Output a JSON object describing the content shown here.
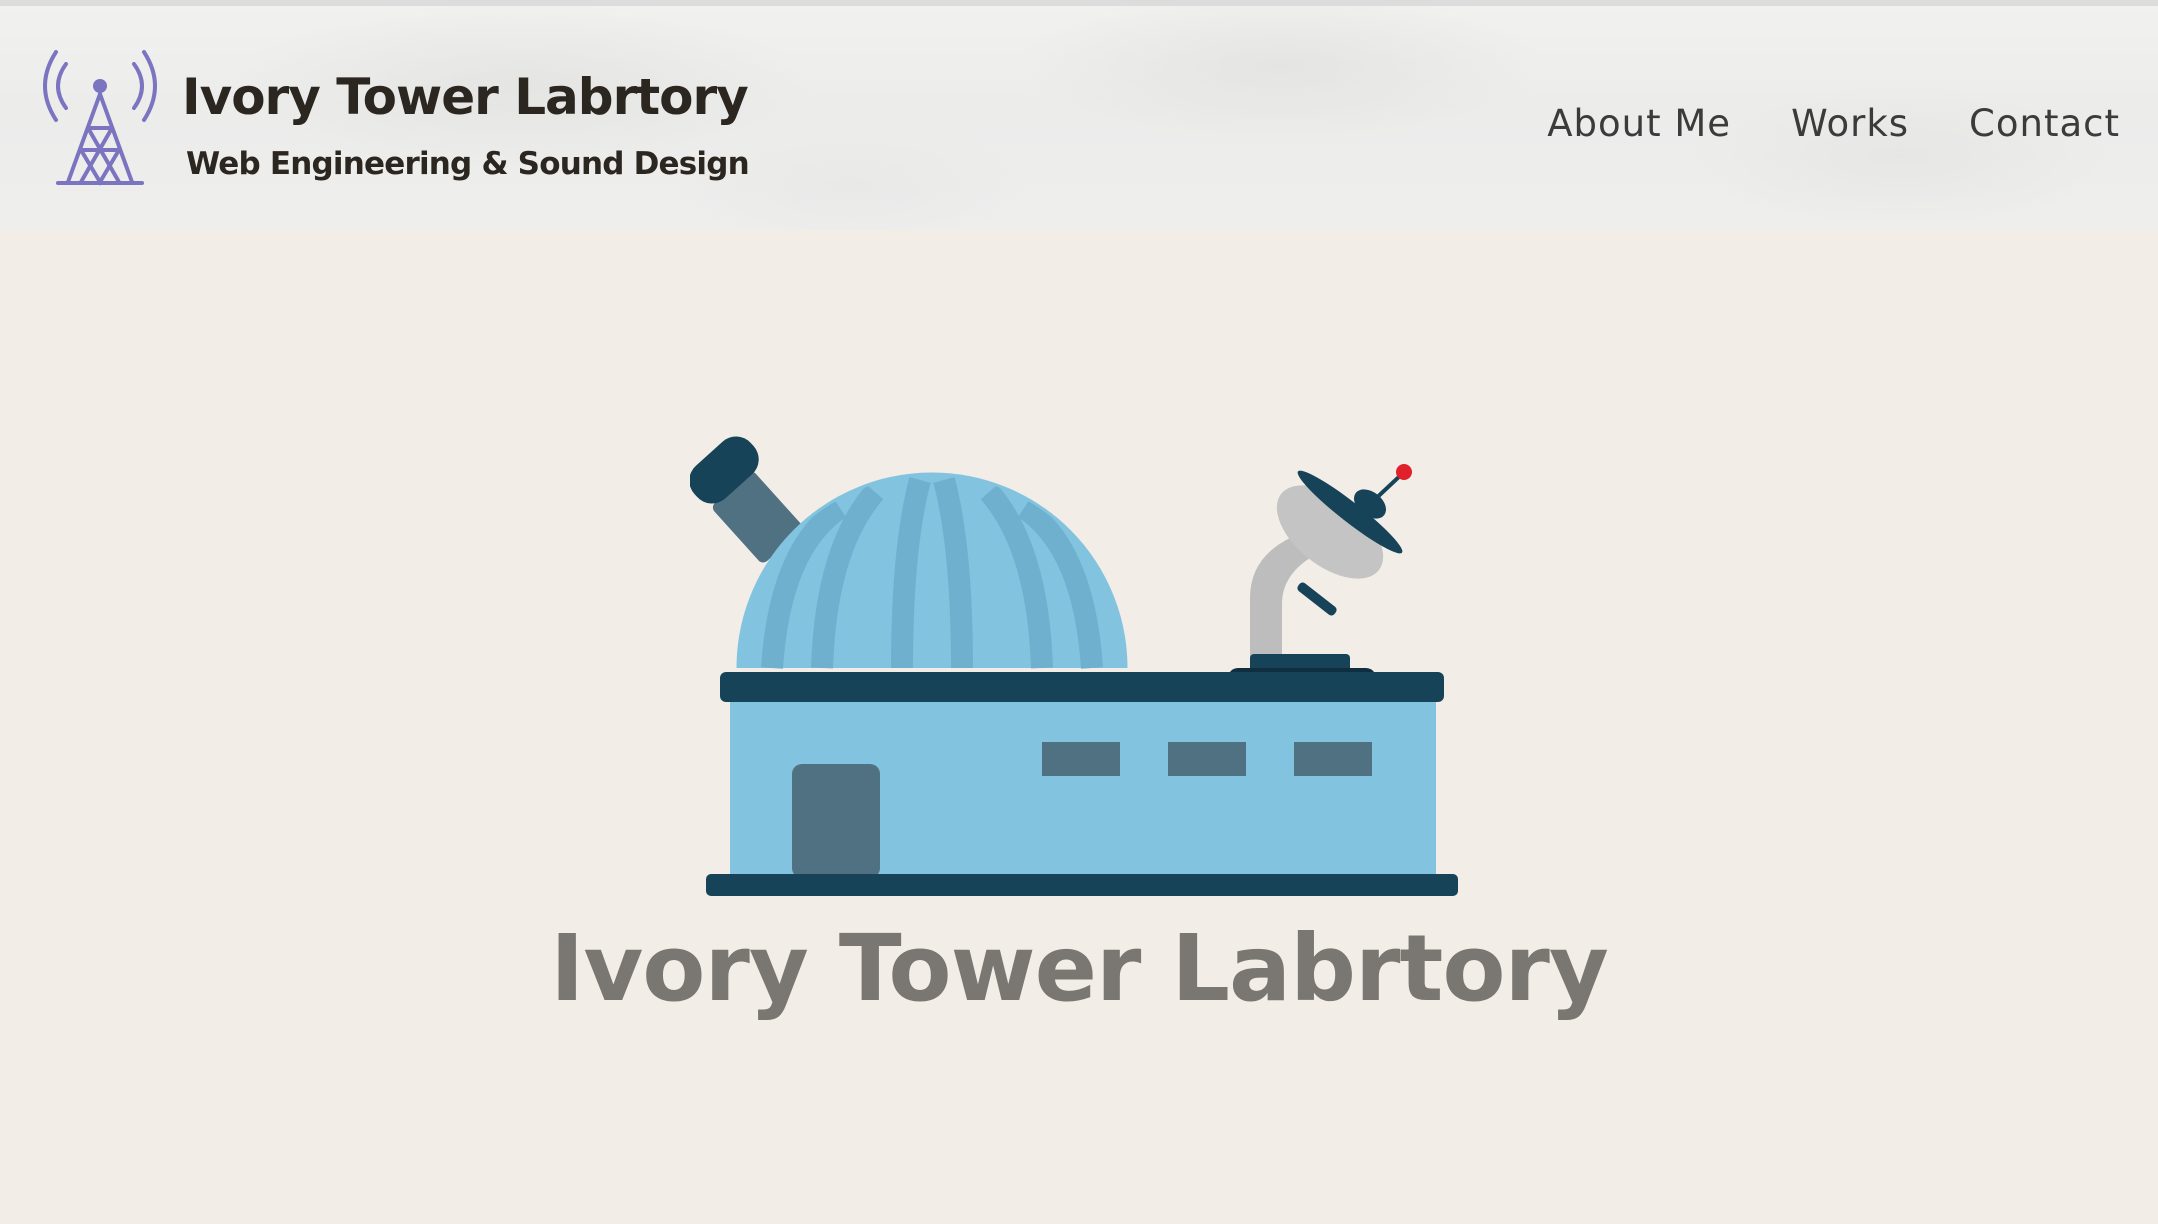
{
  "header": {
    "logo": {
      "title": "Ivory Tower Labrtory",
      "subtitle": "Web Engineering & Sound Design",
      "icon": "radio-tower-icon"
    },
    "nav": [
      {
        "label": "About Me"
      },
      {
        "label": "Works"
      },
      {
        "label": "Contact"
      }
    ]
  },
  "hero": {
    "illustration": "observatory-illustration",
    "title": "Ivory Tower Labrtory"
  },
  "colors": {
    "page_background": "#f2ede6",
    "header_background": "#eeeeed",
    "logo_icon": "#7b74c0",
    "text_dark": "#2c2620",
    "nav_text": "#3b3b3b",
    "hero_title": "#7a7671",
    "building_light": "#82c3e0",
    "building_dark": "#174359",
    "dome_stripe": "#6fb0cf",
    "door_window": "#4f7182",
    "dish_gray": "#bdbdbd",
    "antenna_tip": "#e0202a"
  }
}
